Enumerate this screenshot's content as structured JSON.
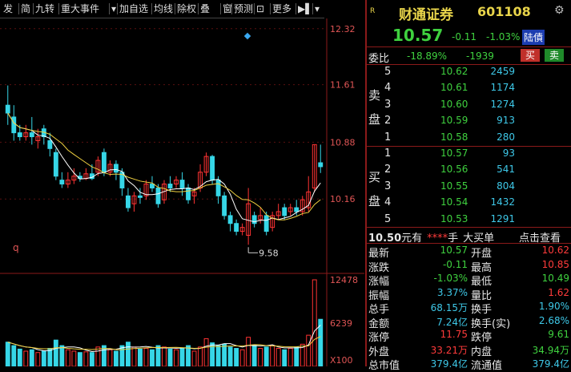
{
  "toolbar": {
    "items": [
      "发",
      "简",
      "九转",
      "重大事件",
      "▾",
      "加自选",
      "均线",
      "除权",
      "叠",
      "窗",
      "预测",
      "⊡",
      "更多",
      "▶▌",
      "▾"
    ]
  },
  "chart": {
    "price_ticks": [
      "12.32",
      "11.61",
      "10.88",
      "10.16"
    ],
    "volume_ticks": [
      "12478",
      "6239",
      "X100"
    ],
    "low_marker": "9.58",
    "q_label": "q",
    "colors": {
      "up": "#ff3333",
      "down": "#36d6e7",
      "ma5": "#ffffff",
      "ma10": "#f0d040",
      "axis": "#8b1a1a"
    }
  },
  "chart_data": {
    "type": "candlestick",
    "title": "",
    "ylim": [
      9.4,
      12.45
    ],
    "candles": [
      {
        "o": 11.35,
        "c": 11.25,
        "h": 11.6,
        "l": 11.1
      },
      {
        "o": 11.2,
        "c": 11.0,
        "h": 11.35,
        "l": 10.9
      },
      {
        "o": 11.0,
        "c": 10.95,
        "h": 11.1,
        "l": 10.9
      },
      {
        "o": 10.95,
        "c": 11.0,
        "h": 11.1,
        "l": 10.9
      },
      {
        "o": 11.0,
        "c": 10.95,
        "h": 11.2,
        "l": 10.85
      },
      {
        "o": 10.9,
        "c": 10.95,
        "h": 11.05,
        "l": 10.8
      },
      {
        "o": 11.05,
        "c": 10.95,
        "h": 11.1,
        "l": 10.85
      },
      {
        "o": 10.9,
        "c": 10.8,
        "h": 11.0,
        "l": 10.7
      },
      {
        "o": 10.75,
        "c": 10.45,
        "h": 10.8,
        "l": 10.4
      },
      {
        "o": 10.4,
        "c": 10.35,
        "h": 10.5,
        "l": 10.3
      },
      {
        "o": 10.35,
        "c": 10.4,
        "h": 10.5,
        "l": 10.3
      },
      {
        "o": 10.4,
        "c": 10.45,
        "h": 10.55,
        "l": 10.35
      },
      {
        "o": 10.45,
        "c": 10.42,
        "h": 10.5,
        "l": 10.38
      },
      {
        "o": 10.42,
        "c": 10.48,
        "h": 10.55,
        "l": 10.4
      },
      {
        "o": 10.48,
        "c": 10.42,
        "h": 10.6,
        "l": 10.4
      },
      {
        "o": 10.5,
        "c": 10.65,
        "h": 10.7,
        "l": 10.45
      },
      {
        "o": 10.75,
        "c": 10.5,
        "h": 10.8,
        "l": 10.45
      },
      {
        "o": 10.5,
        "c": 10.6,
        "h": 10.65,
        "l": 10.45
      },
      {
        "o": 10.6,
        "c": 10.5,
        "h": 10.65,
        "l": 10.4
      },
      {
        "o": 10.5,
        "c": 10.3,
        "h": 10.55,
        "l": 10.2
      },
      {
        "o": 10.2,
        "c": 10.05,
        "h": 10.3,
        "l": 10.0
      },
      {
        "o": 10.1,
        "c": 10.2,
        "h": 10.25,
        "l": 10.0
      },
      {
        "o": 10.2,
        "c": 10.18,
        "h": 10.3,
        "l": 10.1
      },
      {
        "o": 10.2,
        "c": 10.35,
        "h": 10.4,
        "l": 10.15
      },
      {
        "o": 10.35,
        "c": 10.3,
        "h": 10.45,
        "l": 10.25
      },
      {
        "o": 10.3,
        "c": 10.1,
        "h": 10.35,
        "l": 10.05
      },
      {
        "o": 10.15,
        "c": 10.35,
        "h": 10.4,
        "l": 10.1
      },
      {
        "o": 10.35,
        "c": 10.3,
        "h": 10.45,
        "l": 10.25
      },
      {
        "o": 10.35,
        "c": 10.4,
        "h": 10.45,
        "l": 10.3
      },
      {
        "o": 10.4,
        "c": 10.3,
        "h": 10.5,
        "l": 10.2
      },
      {
        "o": 10.3,
        "c": 10.15,
        "h": 10.35,
        "l": 10.1
      },
      {
        "o": 10.2,
        "c": 10.25,
        "h": 10.3,
        "l": 10.1
      },
      {
        "o": 10.3,
        "c": 10.5,
        "h": 10.6,
        "l": 10.25
      },
      {
        "o": 10.5,
        "c": 10.7,
        "h": 10.75,
        "l": 10.45
      },
      {
        "o": 10.7,
        "c": 10.4,
        "h": 10.72,
        "l": 10.35
      },
      {
        "o": 10.4,
        "c": 10.2,
        "h": 10.45,
        "l": 10.1
      },
      {
        "o": 10.2,
        "c": 9.95,
        "h": 10.25,
        "l": 9.9
      },
      {
        "o": 9.95,
        "c": 9.85,
        "h": 10.0,
        "l": 9.75
      },
      {
        "o": 9.85,
        "c": 9.75,
        "h": 9.9,
        "l": 9.7
      },
      {
        "o": 9.75,
        "c": 9.8,
        "h": 9.85,
        "l": 9.7
      },
      {
        "o": 9.7,
        "c": 10.1,
        "h": 10.3,
        "l": 9.58
      },
      {
        "o": 9.95,
        "c": 9.85,
        "h": 10.0,
        "l": 9.8
      },
      {
        "o": 9.9,
        "c": 9.95,
        "h": 10.05,
        "l": 9.85
      },
      {
        "o": 9.95,
        "c": 9.75,
        "h": 10.0,
        "l": 9.7
      },
      {
        "o": 9.8,
        "c": 9.95,
        "h": 10.0,
        "l": 9.75
      },
      {
        "o": 9.95,
        "c": 10.0,
        "h": 10.1,
        "l": 9.9
      },
      {
        "o": 10.05,
        "c": 9.95,
        "h": 10.1,
        "l": 9.9
      },
      {
        "o": 10.0,
        "c": 10.05,
        "h": 10.1,
        "l": 9.95
      },
      {
        "o": 10.05,
        "c": 10.0,
        "h": 10.15,
        "l": 9.95
      },
      {
        "o": 10.0,
        "c": 10.15,
        "h": 10.2,
        "l": 9.95
      },
      {
        "o": 10.05,
        "c": 10.25,
        "h": 10.45,
        "l": 10.0
      },
      {
        "o": 10.3,
        "c": 10.85,
        "h": 10.85,
        "l": 10.25
      },
      {
        "o": 10.62,
        "c": 10.57,
        "h": 10.85,
        "l": 10.49
      }
    ],
    "volume": [
      35,
      30,
      25,
      22,
      24,
      20,
      22,
      26,
      38,
      30,
      24,
      22,
      20,
      21,
      20,
      28,
      30,
      24,
      22,
      30,
      35,
      28,
      25,
      26,
      24,
      30,
      28,
      25,
      24,
      26,
      30,
      22,
      28,
      40,
      34,
      30,
      32,
      28,
      26,
      24,
      42,
      30,
      26,
      28,
      30,
      26,
      24,
      26,
      28,
      32,
      45,
      125,
      68
    ]
  },
  "panel": {
    "badge": "R",
    "stock_name": "财通证券",
    "stock_code": "601108",
    "price": "10.57",
    "change": "-0.11",
    "change_pct": "-1.03%",
    "tag": "陆債",
    "weibi_label": "委比",
    "weibi_pct": "-18.89%",
    "weicha": "-1939",
    "buy_btn": "买",
    "sell_btn": "卖",
    "ask_side_label": [
      "卖",
      "盘"
    ],
    "bid_side_label": [
      "买",
      "盘"
    ],
    "asks": [
      {
        "lvl": "5",
        "price": "10.62",
        "vol": "2459"
      },
      {
        "lvl": "4",
        "price": "10.61",
        "vol": "1174"
      },
      {
        "lvl": "3",
        "price": "10.60",
        "vol": "1274"
      },
      {
        "lvl": "2",
        "price": "10.59",
        "vol": "913"
      },
      {
        "lvl": "1",
        "price": "10.58",
        "vol": "280"
      }
    ],
    "bids": [
      {
        "lvl": "1",
        "price": "10.57",
        "vol": "93"
      },
      {
        "lvl": "2",
        "price": "10.56",
        "vol": "541"
      },
      {
        "lvl": "3",
        "price": "10.55",
        "vol": "804"
      },
      {
        "lvl": "4",
        "price": "10.54",
        "vol": "1432"
      },
      {
        "lvl": "5",
        "price": "10.53",
        "vol": "1291"
      }
    ],
    "bigorder_price": "10.50",
    "bigorder_unit": "元有",
    "bigorder_stars": "****",
    "bigorder_hand": "手",
    "bigorder_label": "大买单",
    "bigorder_link": "点击查看",
    "stats": [
      {
        "l1": "最新",
        "v1": "10.57",
        "c1": "green",
        "l2": "开盘",
        "v2": "10.62",
        "c2": "red"
      },
      {
        "l1": "涨跌",
        "v1": "-0.11",
        "c1": "green",
        "l2": "最高",
        "v2": "10.85",
        "c2": "red"
      },
      {
        "l1": "涨幅",
        "v1": "-1.03%",
        "c1": "green",
        "l2": "最低",
        "v2": "10.49",
        "c2": "green"
      },
      {
        "l1": "振幅",
        "v1": "3.37%",
        "c1": "cyan",
        "l2": "量比",
        "v2": "1.62",
        "c2": "red"
      },
      {
        "l1": "总手",
        "v1": "68.15万",
        "c1": "cyan",
        "l2": "换手",
        "v2": "1.90%",
        "c2": "cyan"
      },
      {
        "l1": "金额",
        "v1": "7.24亿",
        "c1": "cyan",
        "l2": "换手(实)",
        "v2": "2.68%",
        "c2": "cyan"
      },
      {
        "l1": "涨停",
        "v1": "11.75",
        "c1": "red",
        "l2": "跌停",
        "v2": "9.61",
        "c2": "green"
      },
      {
        "l1": "外盘",
        "v1": "33.21万",
        "c1": "red",
        "l2": "内盘",
        "v2": "34.94万",
        "c2": "green"
      },
      {
        "l1": "总市值",
        "v1": "379.4亿",
        "c1": "cyan",
        "l2": "流通值",
        "v2": "379.4亿",
        "c2": "cyan"
      }
    ]
  }
}
